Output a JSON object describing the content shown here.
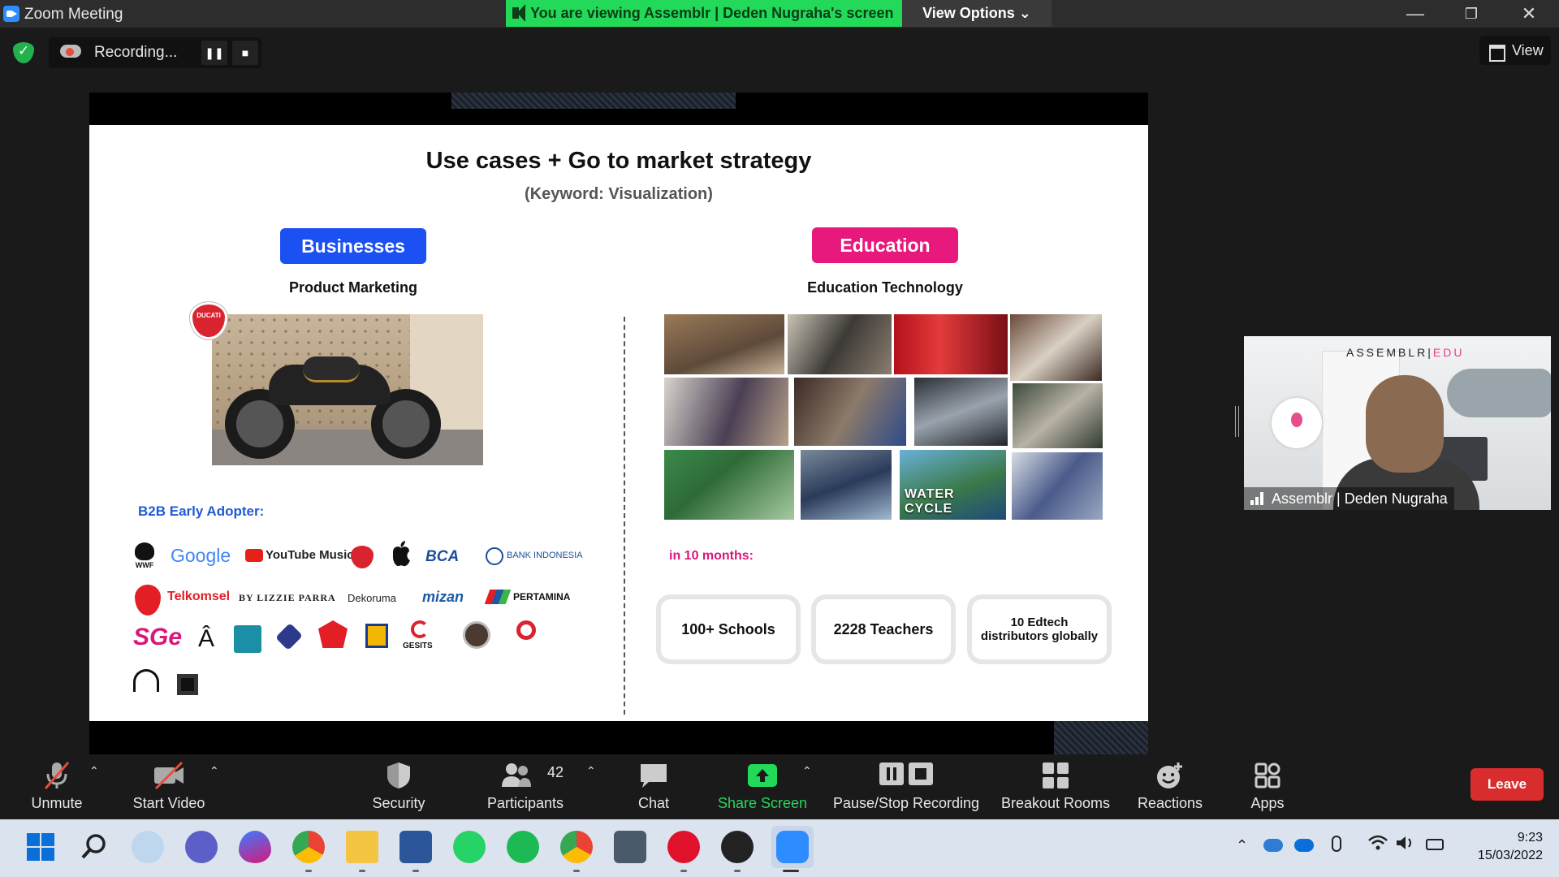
{
  "window": {
    "title": "Zoom Meeting",
    "share_banner": "You are viewing Assemblr | Deden Nugraha's screen",
    "view_options": "View Options ⌄",
    "minimize": "—",
    "restore": "❐",
    "close": "✕"
  },
  "recording": {
    "label": "Recording...",
    "pause": "❚❚",
    "stop": "■"
  },
  "view_button": "View",
  "slide": {
    "title": "Use cases + Go to market strategy",
    "subtitle": "(Keyword: Visualization)",
    "left": {
      "pill": "Businesses",
      "pill_color": "#1b50f2",
      "label": "Product Marketing",
      "badge": "DUCATI",
      "b2b_label": "B2B Early Adopter:",
      "logos": [
        "WWF",
        "Google",
        "YouTube Music",
        "BCA",
        "BANK INDONESIA",
        "Telkomsel",
        "BY LIZZIE PARRA",
        "Dekoruma",
        "mizan",
        "PERTAMINA",
        "SGe",
        "Â",
        "GESITS"
      ]
    },
    "right": {
      "pill": "Education",
      "pill_color": "#e8197d",
      "label": "Education Technology",
      "photo_caption": "WATER CYCLE",
      "months": "in 10 months:",
      "stats": [
        "100+ Schools",
        "2228 Teachers",
        "10 Edtech distributors globally"
      ]
    }
  },
  "participant_tile": {
    "brand_a": "ASSEMBLR",
    "brand_sep": "|",
    "brand_b": "EDU",
    "name": "Assemblr | Deden Nugraha"
  },
  "toolbar": {
    "unmute": "Unmute",
    "start_video": "Start Video",
    "security": "Security",
    "participants": "Participants",
    "participants_count": "42",
    "chat": "Chat",
    "share_screen": "Share Screen",
    "pause_stop": "Pause/Stop Recording",
    "breakout": "Breakout Rooms",
    "reactions": "Reactions",
    "apps": "Apps",
    "leave": "Leave"
  },
  "taskbar": {
    "time": "9:23",
    "date": "15/03/2022"
  }
}
